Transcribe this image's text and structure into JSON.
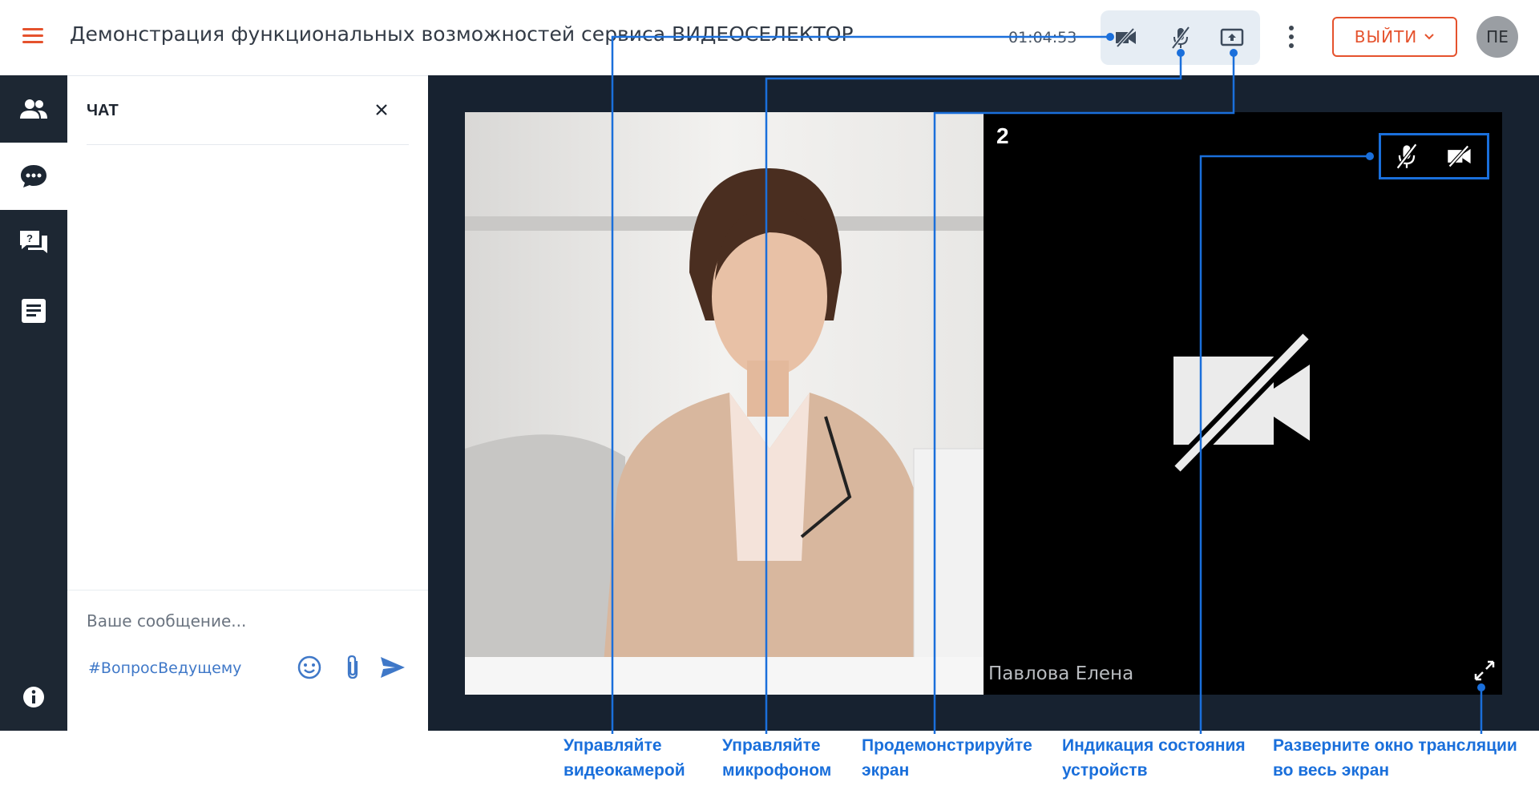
{
  "header": {
    "title": "Демонстрация функциональных возможностей сервиса ВИДЕОСЕЛЕКТОР",
    "timer": "01:04:53",
    "exit_label": "ВЫЙТИ",
    "avatar_initials": "ПЕ"
  },
  "controls": {
    "camera_icon": "camera-off-icon",
    "mic_icon": "mic-off-icon",
    "share_icon": "screen-share-icon"
  },
  "sidebar": {
    "items": [
      {
        "icon": "participants-icon",
        "active": false
      },
      {
        "icon": "chat-icon",
        "active": true
      },
      {
        "icon": "questions-icon",
        "active": false
      },
      {
        "icon": "document-icon",
        "active": false
      }
    ],
    "info_icon": "info-icon"
  },
  "chat": {
    "title": "ЧАТ",
    "message_placeholder": "Ваше сообщение...",
    "hashtag": "#ВопросВедущему"
  },
  "stage": {
    "tile_number": "2",
    "participant_name": "Павлова Елена"
  },
  "annotations": [
    {
      "line1": "Управляйте",
      "line2": "видеокамерой"
    },
    {
      "line1": "Управляйте",
      "line2": "микрофоном"
    },
    {
      "line1": "Продемонстрируйте",
      "line2": "экран"
    },
    {
      "line1": "Индикация состояния",
      "line2": "устройств"
    },
    {
      "line1": "Разверните окно трансляции",
      "line2": "во весь экран"
    }
  ],
  "colors": {
    "accent": "#e5522d",
    "annotation": "#1a6fdb",
    "sidebar": "#1d2733",
    "stage": "#172230",
    "link": "#3f78c8"
  }
}
